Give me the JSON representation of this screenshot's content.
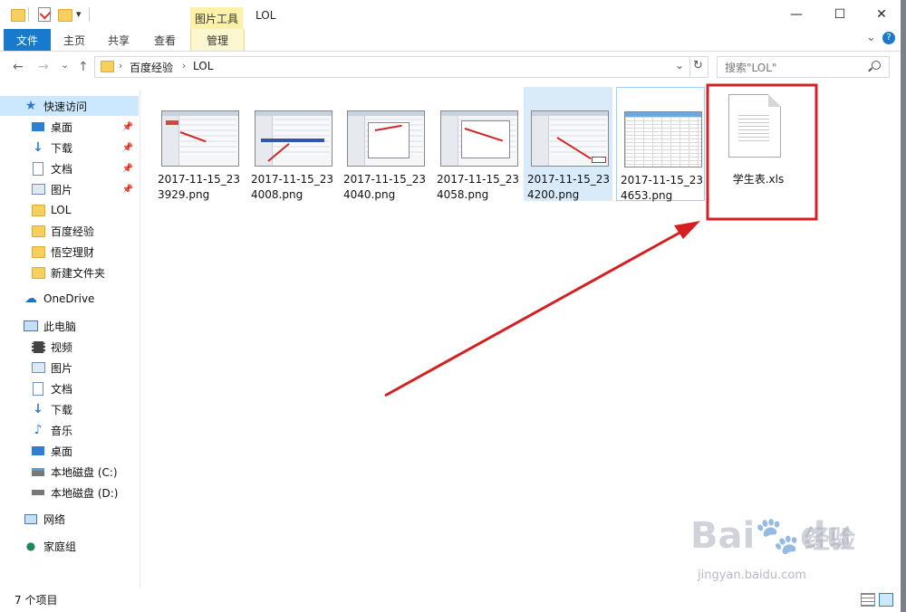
{
  "titlebar": {
    "title": "LOL",
    "context_tab_header": "图片工具",
    "minimize": "—",
    "maximize": "☐",
    "close": "✕"
  },
  "ribbon": {
    "tabs": [
      "文件",
      "主页",
      "共享",
      "查看",
      "管理"
    ],
    "collapse": "⌄",
    "help": "?"
  },
  "nav": {
    "back": "←",
    "forward": "→",
    "recent": "⌄",
    "up": "↑",
    "breadcrumb": [
      "百度经验",
      "LOL"
    ],
    "separator": "›",
    "refresh": "↻",
    "dropdown": "⌄",
    "search_placeholder": "搜索\"LOL\""
  },
  "sidebar": {
    "quick_access": "快速访问",
    "pinned": [
      "桌面",
      "下载",
      "文档",
      "图片"
    ],
    "folders": [
      "LOL",
      "百度经验",
      "悟空理财",
      "新建文件夹"
    ],
    "onedrive": "OneDrive",
    "this_pc": "此电脑",
    "pc_items": [
      "视频",
      "图片",
      "文档",
      "下载",
      "音乐",
      "桌面",
      "本地磁盘 (C:)",
      "本地磁盘 (D:)"
    ],
    "network": "网络",
    "homegroup": "家庭组"
  },
  "files": [
    {
      "name": "2017-11-15_233929.png"
    },
    {
      "name": "2017-11-15_234008.png"
    },
    {
      "name": "2017-11-15_234040.png"
    },
    {
      "name": "2017-11-15_234058.png"
    },
    {
      "name": "2017-11-15_234200.png"
    },
    {
      "name": "2017-11-15_234653.png"
    },
    {
      "name": "学生表.xls"
    }
  ],
  "status": {
    "count": "7 个项目"
  },
  "watermark": {
    "brand": "Bai",
    "brand2": "du",
    "cn": "经验",
    "url": "jingyan.baidu.com"
  },
  "colors": {
    "accent": "#1979ca",
    "context": "#fbf1a9",
    "selection": "#cce8ff",
    "annotation": "#d42020"
  }
}
